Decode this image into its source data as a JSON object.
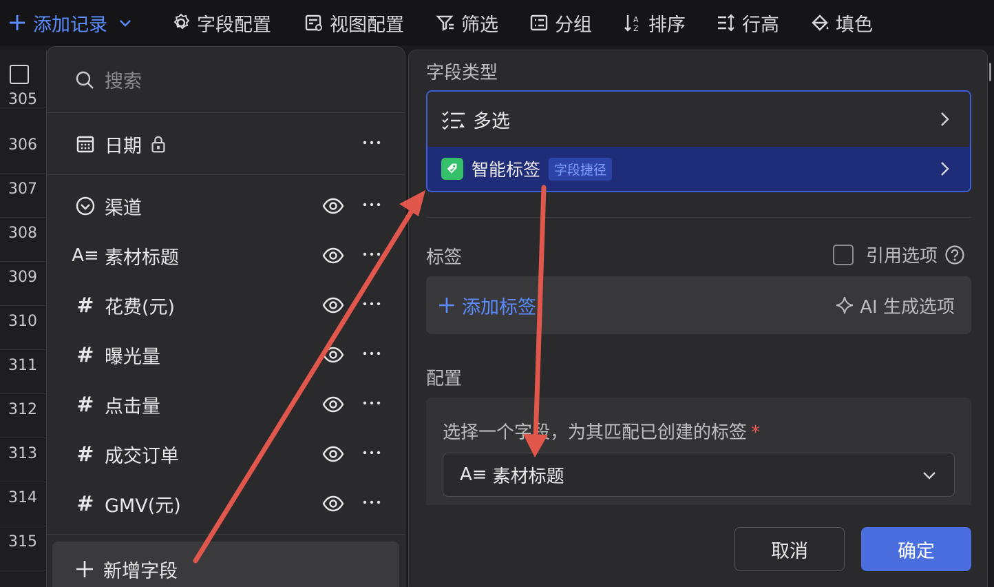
{
  "colors": {
    "accent": "#5b8cff",
    "arrow": "#e2574c",
    "confirm": "#4a6ee0",
    "smart_tag_bg": "#1f2d78"
  },
  "toolbar": {
    "add_record": "添加记录",
    "field_config": "字段配置",
    "view_config": "视图配置",
    "filter": "筛选",
    "group": "分组",
    "sort": "排序",
    "row_height": "行高",
    "fill_color": "填色"
  },
  "grid": {
    "rows": [
      "305",
      "306",
      "307",
      "308",
      "309",
      "310",
      "311",
      "312",
      "313",
      "314",
      "315"
    ]
  },
  "field_panel": {
    "search_placeholder": "搜索",
    "locked_field": {
      "label": "日期",
      "icon": "calendar-icon"
    },
    "fields": [
      {
        "label": "渠道",
        "icon": "single-select-icon"
      },
      {
        "label": "素材标题",
        "icon": "text-icon"
      },
      {
        "label": "花费(元)",
        "icon": "number-icon"
      },
      {
        "label": "曝光量",
        "icon": "number-icon"
      },
      {
        "label": "点击量",
        "icon": "number-icon"
      },
      {
        "label": "成交订单",
        "icon": "number-icon"
      },
      {
        "label": "GMV(元)",
        "icon": "number-icon"
      }
    ],
    "add_field": "新增字段"
  },
  "config_panel": {
    "field_type_label": "字段类型",
    "type_multi": "多选",
    "type_smart_tag": "智能标签",
    "shortcut_badge": "字段捷径",
    "tags_label": "标签",
    "reference_option": "引用选项",
    "add_tag": "添加标签",
    "ai_generate": "AI 生成选项",
    "config_label": "配置",
    "config_hint": "选择一个字段，为其匹配已创建的标签",
    "required_mark": "*",
    "selected_field": "素材标题",
    "cancel": "取消",
    "confirm": "确定"
  }
}
